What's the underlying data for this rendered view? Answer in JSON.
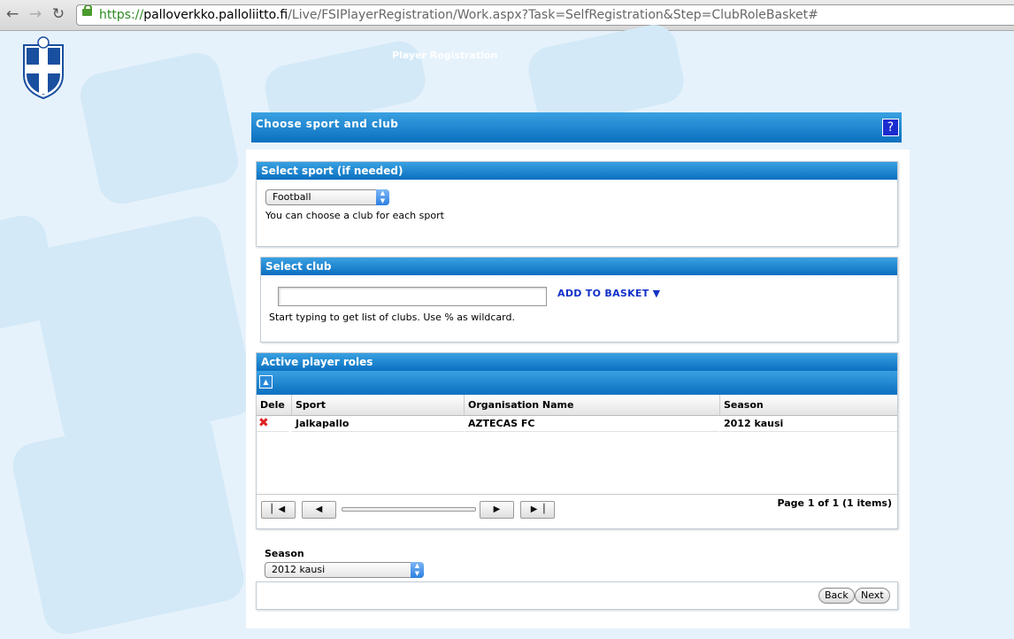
{
  "browser": {
    "url_scheme": "https://",
    "url_host": "palloverkko.palloliitto.fi",
    "url_path": "/Live/FSIPlayerRegistration/Work.aspx?Task=SelfRegistration&Step=ClubRoleBasket#"
  },
  "header": {
    "app_title": "Player Registration"
  },
  "main": {
    "title": "Choose sport and club",
    "help_label": "?"
  },
  "sport_panel": {
    "title": "Select sport (if needed)",
    "selected_sport": "Football",
    "hint": "You can choose a club for each sport"
  },
  "club_panel": {
    "title": "Select club",
    "input_value": "",
    "add_basket_label": "ADD TO BASKET ▼",
    "hint": "Start typing to get list of clubs. Use % as wildcard."
  },
  "roles_panel": {
    "title": "Active player roles",
    "columns": [
      "Dele",
      "Sport",
      "Organisation Name",
      "Season"
    ],
    "rows": [
      {
        "sport": "Jalkapallo",
        "organisation": "AZTECAS FC",
        "season": "2012 kausi"
      }
    ],
    "pager_text": "Page 1 of 1 (1 items)"
  },
  "season": {
    "label": "Season",
    "selected": "2012 kausi"
  },
  "buttons": {
    "back": "Back",
    "next": "Next"
  },
  "colors": {
    "header_blue": "#0a6fc0",
    "link_blue": "#1231c8",
    "delete_red": "#dd2222"
  }
}
